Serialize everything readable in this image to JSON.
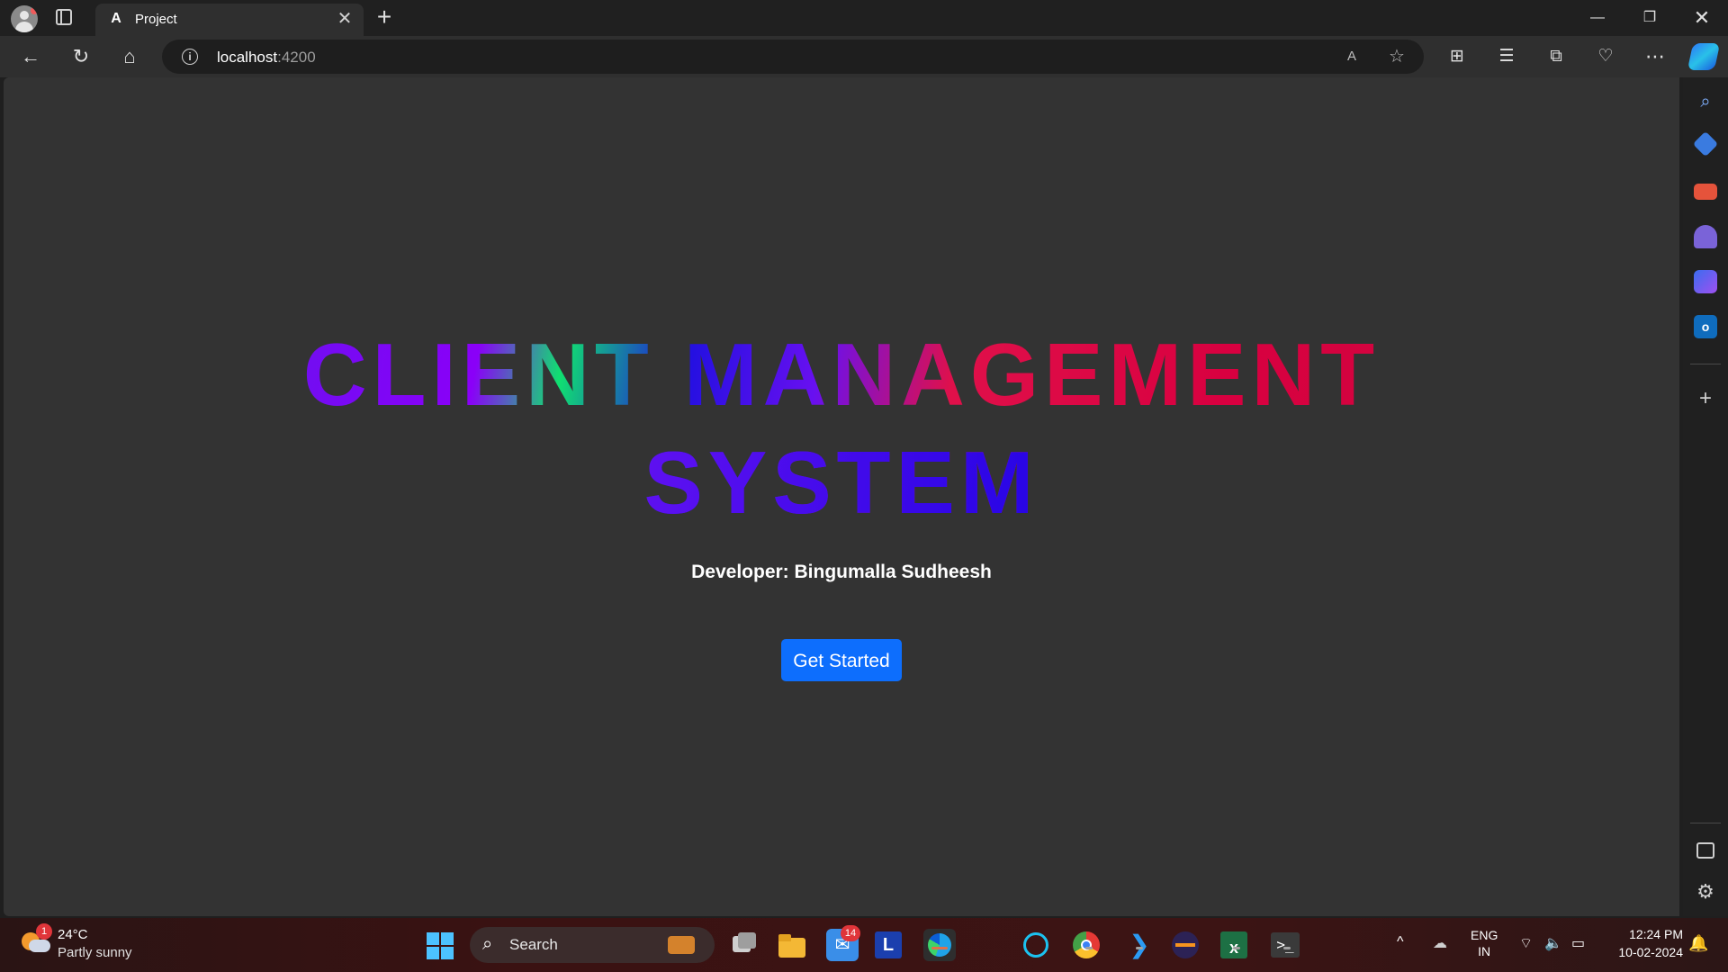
{
  "browser": {
    "tab": {
      "title": "Project",
      "favicon": "A",
      "close": "✕"
    },
    "new_tab": "+",
    "window": {
      "minimize": "—",
      "restore": "❐",
      "close": "✕"
    },
    "address": {
      "host": "localhost",
      "port": ":4200",
      "info": "i"
    },
    "toolbar": {
      "back": "←",
      "reload": "↻",
      "home": "⌂",
      "read_aloud": "A",
      "favorite": "☆",
      "split": "⊞",
      "favorites": "☰",
      "collections": "⧉",
      "health": "♡",
      "more": "⋯"
    }
  },
  "page": {
    "title_line1": "CLIENT MANAGEMENT",
    "title_line2": "SYSTEM",
    "developer": "Developer: Bingumalla Sudheesh",
    "button": "Get Started"
  },
  "sidebar": {
    "search": "⌕",
    "outlook": "o",
    "add": "+",
    "settings": "⚙"
  },
  "taskbar": {
    "weather": {
      "temp": "24°C",
      "desc": "Partly sunny",
      "badge": "1"
    },
    "search_placeholder": "Search",
    "mail_badge": "14",
    "l_app": "L",
    "excel": "x",
    "terminal": ">_",
    "vscode": "❯",
    "lang": {
      "line1": "ENG",
      "line2": "IN"
    },
    "time": "12:24 PM",
    "date": "10-02-2024",
    "tray": {
      "chevron": "^",
      "onedrive": "☁",
      "wifi": "⌔",
      "volume": "🔈",
      "battery": "▭",
      "bell": "🔔"
    }
  },
  "colors": {
    "button_bg": "#0d6efd",
    "page_bg": "#333333",
    "title_gradient": [
      "#1400e0",
      "#8a00f8",
      "#10e070",
      "#e0104a"
    ]
  }
}
